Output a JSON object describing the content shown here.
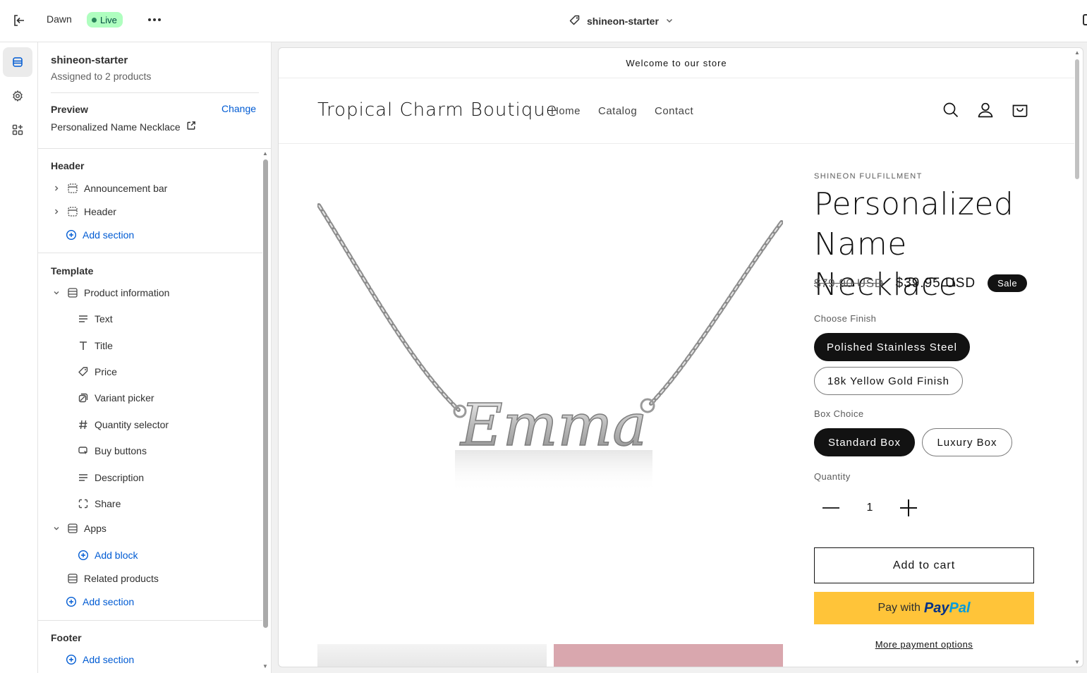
{
  "topbar": {
    "theme_name": "Dawn",
    "status": "Live",
    "template_name": "shineon-starter"
  },
  "rail": {
    "items": [
      "sections-icon",
      "settings-icon",
      "apps-icon"
    ]
  },
  "sidebar": {
    "title": "shineon-starter",
    "subtitle": "Assigned to 2 products",
    "preview_label": "Preview",
    "change_label": "Change",
    "preview_product": "Personalized Name Necklace",
    "header_group": "Header",
    "header_items": [
      "Announcement bar",
      "Header"
    ],
    "add_section": "Add section",
    "template_group": "Template",
    "product_information": "Product information",
    "blocks": [
      "Text",
      "Title",
      "Price",
      "Variant picker",
      "Quantity selector",
      "Buy buttons",
      "Description",
      "Share"
    ],
    "apps": "Apps",
    "add_block": "Add block",
    "related_products": "Related products",
    "footer_group": "Footer"
  },
  "store": {
    "announcement": "Welcome to our store",
    "logo": "Tropical Charm Boutique",
    "nav": [
      "Home",
      "Catalog",
      "Contact"
    ],
    "vendor": "SHINEON FULFILLMENT",
    "product_title": "Personalized Name Necklace",
    "price_old": "$79.90 USD",
    "price_new": "$39.95 USD",
    "sale_badge": "Sale",
    "finish_label": "Choose Finish",
    "finish_options": [
      "Polished Stainless Steel",
      "18k Yellow Gold Finish"
    ],
    "finish_selected": "Polished Stainless Steel",
    "box_label": "Box Choice",
    "box_options": [
      "Standard Box",
      "Luxury Box"
    ],
    "box_selected": "Standard Box",
    "quantity_label": "Quantity",
    "quantity_value": "1",
    "add_to_cart": "Add to cart",
    "paypal_prefix": "Pay with",
    "paypal_brand_1": "Pay",
    "paypal_brand_2": "Pal",
    "more_payment": "More payment options",
    "pendant_text": "Emma"
  },
  "colors": {
    "accent": "#005bd3",
    "live_badge": "#affebf",
    "paypal": "#ffc439",
    "ink": "#121212"
  }
}
